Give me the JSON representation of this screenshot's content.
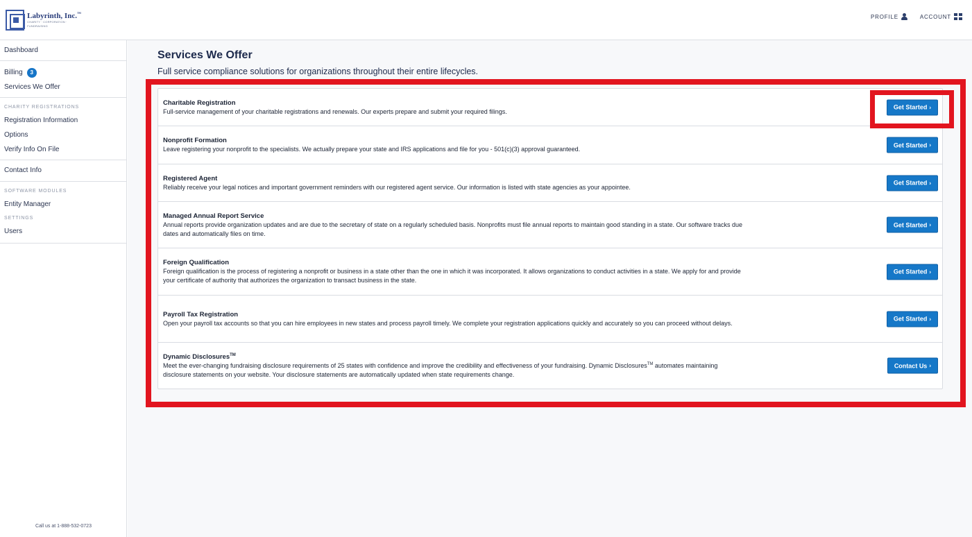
{
  "brand": {
    "name": "Labyrinth, Inc.",
    "name_tm": "™",
    "tagline": "CHARITY · CORPORATION · FUNDRAISING"
  },
  "top_nav": {
    "profile": "PROFILE",
    "account": "ACCOUNT",
    "profile_icon": "person-icon",
    "account_icon": "grid-icon"
  },
  "sidebar": {
    "dashboard": "Dashboard",
    "billing": "Billing",
    "billing_badge": "3",
    "services": "Services We Offer",
    "charity_heading": "CHARITY REGISTRATIONS",
    "registration_info": "Registration Information",
    "options": "Options",
    "verify_info": "Verify Info On File",
    "contact_info": "Contact Info",
    "software_heading": "SOFTWARE MODULES",
    "entity_manager": "Entity Manager",
    "settings_heading": "SETTINGS",
    "users": "Users",
    "call_us": "Call us at 1-888-532-0723"
  },
  "main": {
    "title": "Services We Offer",
    "subtitle": "Full service compliance solutions for organizations throughout their entire lifecycles."
  },
  "services": [
    {
      "title": "Charitable Registration",
      "desc": "Full-service management of your charitable registrations and renewals. Our experts prepare and submit your required filings.",
      "button": "Get Started"
    },
    {
      "title": "Nonprofit Formation",
      "desc": "Leave registering your nonprofit to the specialists. We actually prepare your state and IRS applications and file for you - 501(c)(3) approval guaranteed.",
      "button": "Get Started"
    },
    {
      "title": "Registered Agent",
      "desc": "Reliably receive your legal notices and important government reminders with our registered agent service. Our information is listed with state agencies as your appointee.",
      "button": "Get Started"
    },
    {
      "title": "Managed Annual Report Service",
      "desc": "Annual reports provide organization updates and are due to the secretary of state on a regularly scheduled basis. Nonprofits must file annual reports to maintain good standing in a state. Our software tracks due dates and automatically files on time.",
      "button": "Get Started"
    },
    {
      "title": "Foreign Qualification",
      "desc": "Foreign qualification is the process of registering a nonprofit or business in a state other than the one in which it was incorporated. It allows organizations to conduct activities in a state. We apply for and provide your certificate of authority that authorizes the organization to transact business in the state.",
      "button": "Get Started"
    },
    {
      "title": "Payroll Tax Registration",
      "desc": "Open your payroll tax accounts so that you can hire employees in new states and process payroll timely. We complete your registration applications quickly and accurately so you can proceed without delays.",
      "button": "Get Started"
    },
    {
      "title": "Dynamic Disclosures",
      "title_tm": "TM",
      "desc_part1": "Meet the ever-changing fundraising disclosure requirements of 25 states with confidence and improve the credibility and effectiveness of your fundraising. Dynamic Disclosures",
      "desc_tm": "TM",
      "desc_part2": " automates maintaining disclosure statements on your website. Your disclosure statements are automatically updated when state requirements change.",
      "button": "Contact Us"
    }
  ],
  "colors": {
    "primary_button": "#1678c8",
    "annotation_red": "#e2151f",
    "badge": "#1675c7"
  }
}
